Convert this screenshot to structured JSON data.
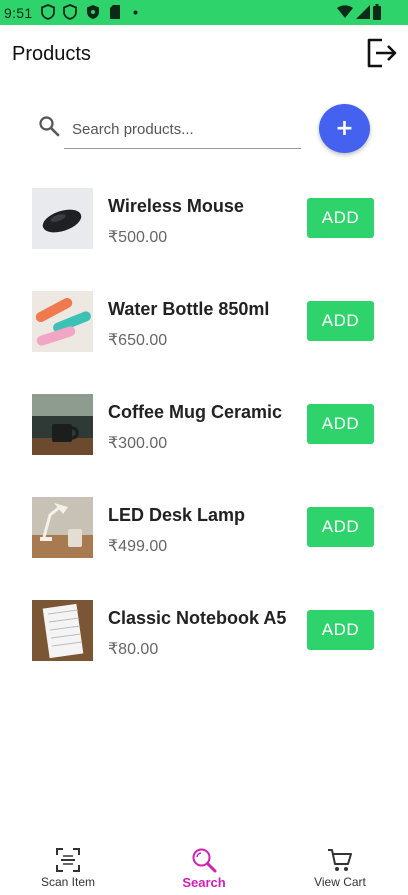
{
  "status_bar": {
    "time": "9:51"
  },
  "header": {
    "title": "Products"
  },
  "search": {
    "placeholder": "Search products..."
  },
  "fab": {
    "label": "+"
  },
  "products": [
    {
      "name": "Wireless Mouse",
      "price": "₹500.00",
      "add_label": "ADD"
    },
    {
      "name": "Water Bottle 850ml",
      "price": "₹650.00",
      "add_label": "ADD"
    },
    {
      "name": "Coffee Mug Ceramic",
      "price": "₹300.00",
      "add_label": "ADD"
    },
    {
      "name": "LED Desk Lamp",
      "price": "₹499.00",
      "add_label": "ADD"
    },
    {
      "name": "Classic Notebook A5",
      "price": "₹80.00",
      "add_label": "ADD"
    }
  ],
  "bottom_nav": {
    "items": [
      {
        "label": "Scan Item",
        "icon": "scan-icon"
      },
      {
        "label": "Search",
        "icon": "search-icon"
      },
      {
        "label": "View Cart",
        "icon": "cart-icon"
      }
    ],
    "active": "Search"
  },
  "colors": {
    "accent_green": "#2fd36b",
    "fab_blue": "#4461ef",
    "nav_active": "#d21fb3"
  }
}
